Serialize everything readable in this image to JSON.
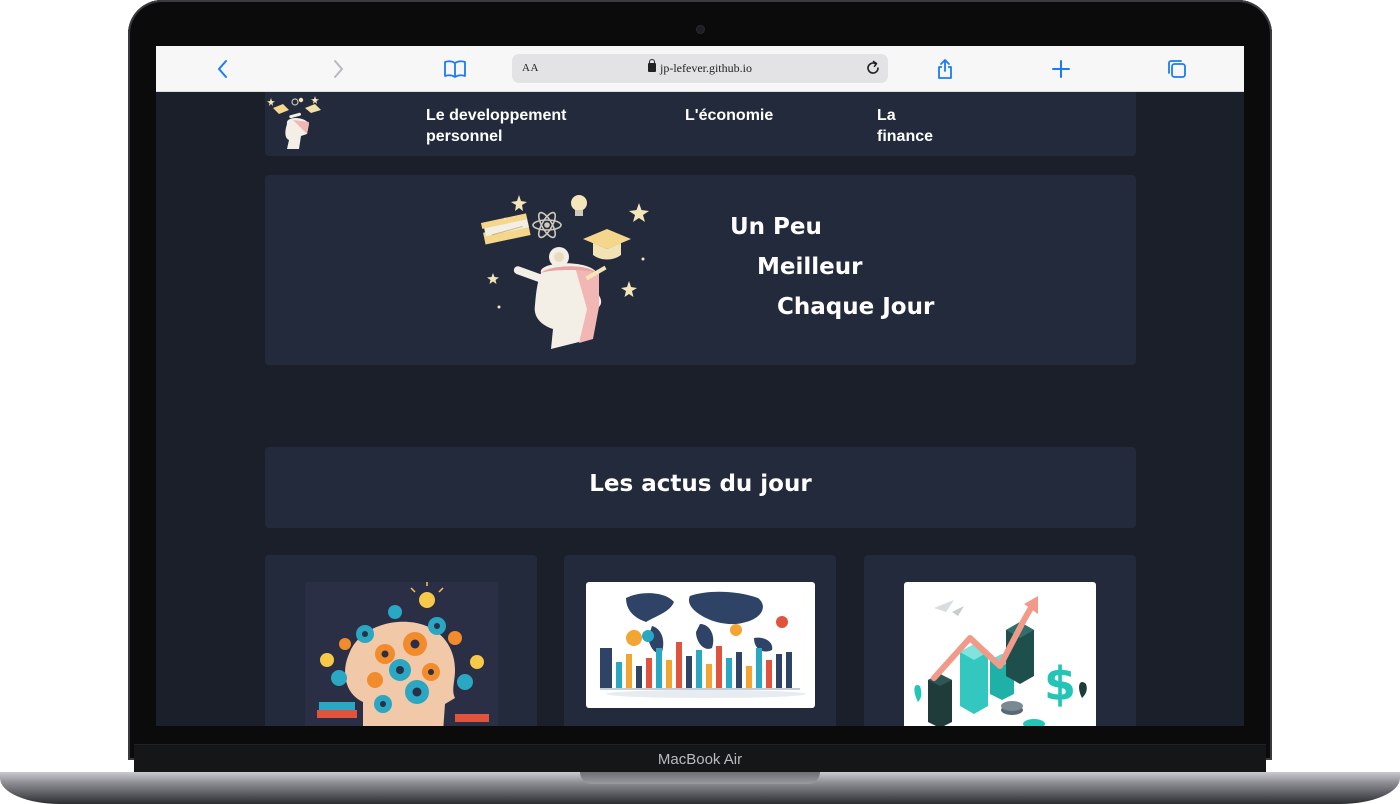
{
  "device": {
    "model_label": "MacBook Air"
  },
  "browser": {
    "text_size_label": "AA",
    "url": "jp-lefever.github.io",
    "icons": [
      "chevron-left-icon",
      "chevron-right-icon",
      "book-icon",
      "lock-icon",
      "reload-icon",
      "share-icon",
      "plus-icon",
      "tabs-icon"
    ],
    "accent_color": "#1a7cf5"
  },
  "nav": {
    "links": [
      {
        "label_line1": "Le developpement",
        "label_line2": "personnel"
      },
      {
        "label_line1": "L'économie",
        "label_line2": ""
      },
      {
        "label_line1": "La",
        "label_line2": "finance"
      }
    ]
  },
  "hero": {
    "lines": [
      "Un Peu",
      "Meilleur",
      "Chaque Jour"
    ]
  },
  "news": {
    "title": "Les actus du jour",
    "cards": [
      {
        "image": "brain-gears-illustration"
      },
      {
        "image": "world-map-economy-illustration"
      },
      {
        "image": "finance-growth-chart-illustration"
      }
    ]
  },
  "colors": {
    "page_background": "#1a1f29",
    "panel_background": "#232a3b",
    "text": "#ffffff"
  }
}
